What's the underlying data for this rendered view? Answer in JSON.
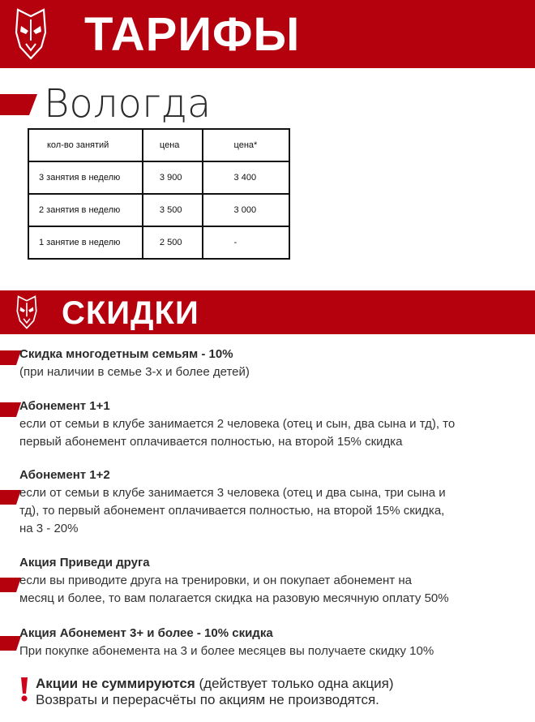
{
  "header": {
    "title": "ТАРИФЫ",
    "logo_icon": "warrior-mask-icon"
  },
  "city": "Вологда",
  "price_table": {
    "headers": [
      "кол-во занятий",
      "цена",
      "цена*"
    ],
    "rows": [
      [
        "3 занятия в неделю",
        "3 900",
        "3 400"
      ],
      [
        "2 занятия в неделю",
        "3 500",
        "3 000"
      ],
      [
        "1 занятие в неделю",
        "2 500",
        "-"
      ]
    ]
  },
  "discounts": {
    "title": "СКИДКИ",
    "logo_icon": "warrior-mask-icon",
    "offers": [
      {
        "title": "Скидка многодетным семьям - 10%",
        "lines": [
          "(при наличии в семье 3-х и более детей)"
        ]
      },
      {
        "title": "Абонемент 1+1",
        "lines": [
          "если от семьи в клубе занимается 2 человека (отец и сын, два сына и тд), то",
          "первый абонемент оплачивается полностью, на второй 15% скидка"
        ]
      },
      {
        "title": "Абонемент 1+2",
        "lines": [
          "если от семьи в клубе занимается 3 человека (отец и два сына, три сына и",
          "тд), то первый абонемент оплачивается полностью, на второй 15% скидка,",
          "на 3 - 20%"
        ]
      },
      {
        "title": "Акция Приведи друга",
        "lines": [
          "если вы приводите друга на тренировки, и он покупает абонемент на",
          "месяц и более, то вам полагается скидка на разовую месячную оплату 50%"
        ]
      },
      {
        "title": "Акция Абонемент 3+ и более - 10% скидка",
        "lines": [
          "При покупке абонемента на 3 и более месяцев вы получаете скидку 10%"
        ]
      }
    ]
  },
  "notice": {
    "icon": "exclamation-icon",
    "bold": "Акции не суммируются",
    "rest": " (действует только одна акция)",
    "line2": "Возвраты и перерасчёты по акциям не производятся."
  },
  "colors": {
    "brand_red": "#b5000d",
    "text": "#2b2b2b"
  }
}
